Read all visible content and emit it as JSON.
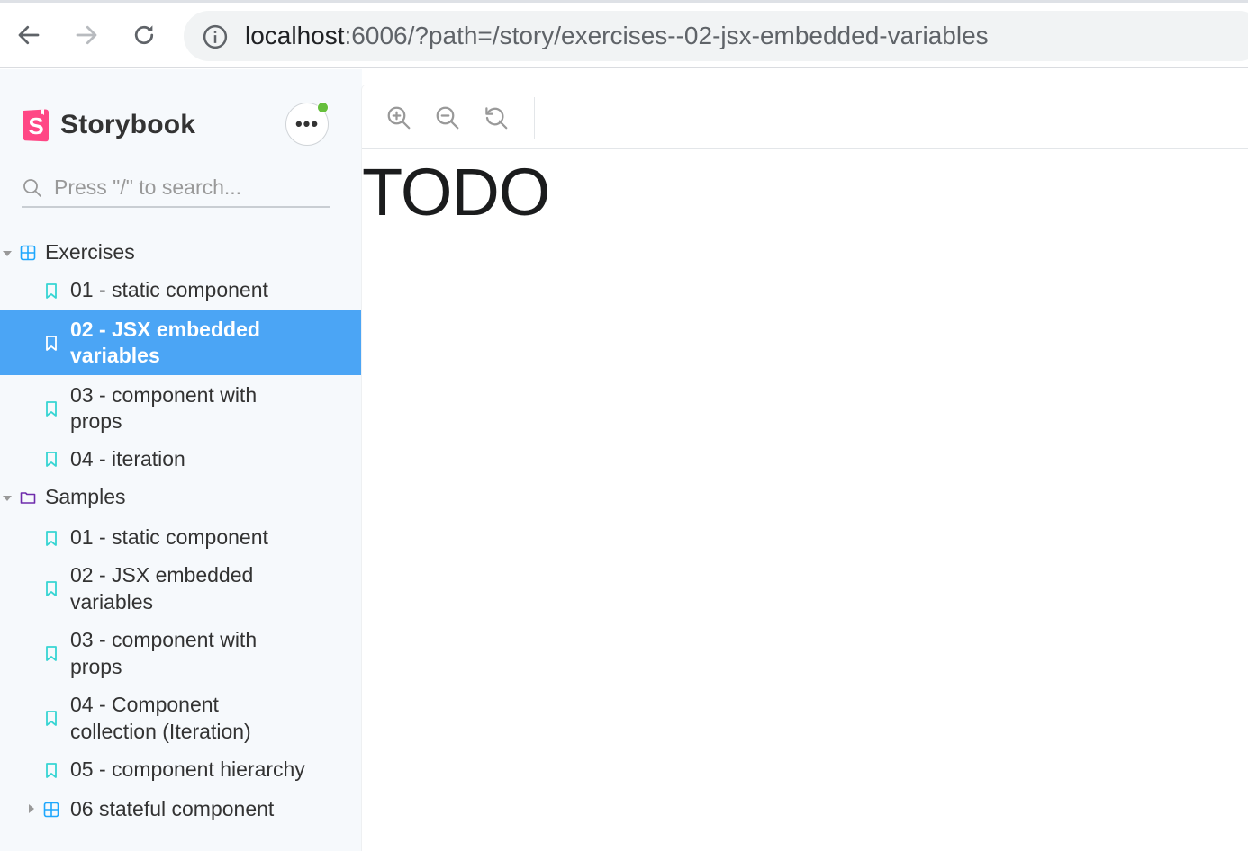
{
  "browser": {
    "url_host": "localhost",
    "url_path": ":6006/?path=/story/exercises--02-jsx-embedded-variables",
    "icons": [
      "back-icon",
      "forward-icon",
      "reload-icon",
      "info-icon"
    ]
  },
  "sidebar": {
    "brand": "Storybook",
    "search_placeholder": "Press \"/\" to search...",
    "status_color": "#66bf3c",
    "groups": [
      {
        "label": "Exercises",
        "expanded": true,
        "items": [
          {
            "label": "01 - static component",
            "selected": false
          },
          {
            "label": "02 - JSX embedded variables",
            "selected": true
          },
          {
            "label": "03 - component with props",
            "selected": false
          },
          {
            "label": "04 - iteration",
            "selected": false
          }
        ]
      },
      {
        "label": "Samples",
        "expanded": true,
        "items": [
          {
            "label": "01 - static component"
          },
          {
            "label": "02 - JSX embedded variables"
          },
          {
            "label": "03 - component with props"
          },
          {
            "label": "04 - Component collection (Iteration)"
          },
          {
            "label": "05 - component hierarchy"
          }
        ],
        "subgroups": [
          {
            "label": "06 stateful component",
            "expanded": false
          }
        ]
      }
    ]
  },
  "preview": {
    "content": "TODO",
    "toolbar_icons": [
      "zoom-in-icon",
      "zoom-out-icon",
      "zoom-reset-icon"
    ]
  },
  "colors": {
    "accent": "#4ba5f5",
    "sidebar_bg": "#f6f9fc",
    "story_icon": "#37d5d3",
    "component_icon": "#1ea7fd",
    "folder_icon": "#6f2cac",
    "brand_pink": "#ff4785"
  }
}
